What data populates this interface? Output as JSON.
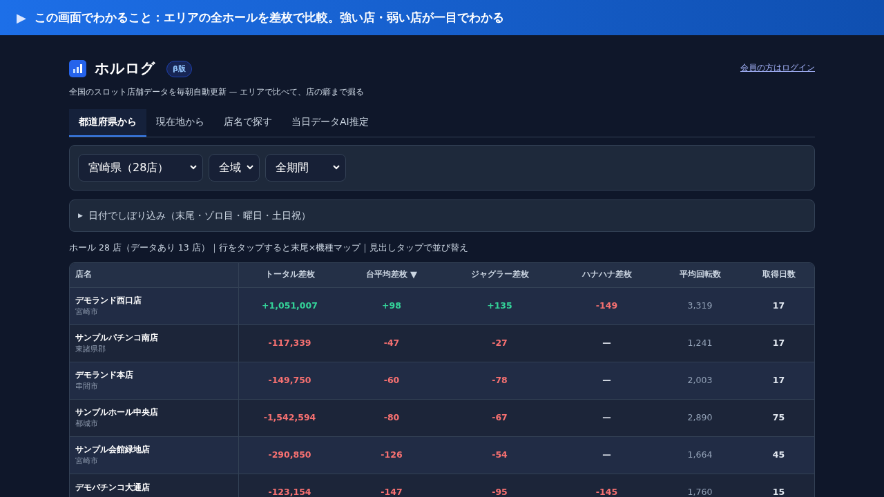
{
  "banner": {
    "arrow": "▶",
    "text": "この画面でわかること：エリアの全ホールを差枚で比較。強い店・弱い店が一目でわかる"
  },
  "header": {
    "title": "ホルログ",
    "badge": "β版",
    "subtitle": "全国のスロット店舗データを毎朝自動更新 — エリアで比べて、店の癖まで掘る",
    "login": "会員の方はログイン"
  },
  "tabs": [
    {
      "label": "都道府県から",
      "selected": true
    },
    {
      "label": "現在地から",
      "selected": false
    },
    {
      "label": "店名で探す",
      "selected": false
    },
    {
      "label": "当日データAI推定",
      "selected": false
    }
  ],
  "filters": [
    {
      "value": "宮崎県（28店）"
    },
    {
      "value": "全域"
    },
    {
      "value": "全期間"
    }
  ],
  "date_filter": {
    "marker": "▶",
    "label": "日付でしぼり込み（末尾・ゾロ目・曜日・土日祝）",
    "expanded": false
  },
  "summary": "ホール 28 店（データあり 13 店）｜行をタップすると末尾×機種マップ｜見出しタップで並び替え",
  "table": {
    "columns": [
      {
        "label": "店名"
      },
      {
        "label": "トータル差枚"
      },
      {
        "label": "台平均差枚",
        "sort_mark": "▼"
      },
      {
        "label": "ジャグラー差枚"
      },
      {
        "label": "ハナハナ差枚"
      },
      {
        "label": "平均回転数"
      },
      {
        "label": "取得日数"
      }
    ],
    "rows": [
      {
        "cells": [
          {
            "text": "デモランド西口店",
            "sub": "宮崎市",
            "kind": "store"
          },
          {
            "text": "+1,051,007",
            "kind": "plus"
          },
          {
            "text": "+98",
            "kind": "plus"
          },
          {
            "text": "+135",
            "kind": "plus"
          },
          {
            "text": "-149",
            "kind": "minus"
          },
          {
            "text": "3,319",
            "kind": "muted"
          },
          {
            "text": "17",
            "kind": "plain"
          }
        ]
      },
      {
        "cells": [
          {
            "text": "サンプルパチンコ南店",
            "sub": "東諸県郡",
            "kind": "store"
          },
          {
            "text": "-117,339",
            "kind": "minus"
          },
          {
            "text": "-47",
            "kind": "minus"
          },
          {
            "text": "-27",
            "kind": "minus"
          },
          {
            "text": "—",
            "kind": "plain"
          },
          {
            "text": "1,241",
            "kind": "muted"
          },
          {
            "text": "17",
            "kind": "plain"
          }
        ]
      },
      {
        "cells": [
          {
            "text": "デモランド本店",
            "sub": "串間市",
            "kind": "store"
          },
          {
            "text": "-149,750",
            "kind": "minus"
          },
          {
            "text": "-60",
            "kind": "minus"
          },
          {
            "text": "-78",
            "kind": "minus"
          },
          {
            "text": "—",
            "kind": "plain"
          },
          {
            "text": "2,003",
            "kind": "muted"
          },
          {
            "text": "17",
            "kind": "plain"
          }
        ]
      },
      {
        "cells": [
          {
            "text": "サンプルホール中央店",
            "sub": "都城市",
            "kind": "store"
          },
          {
            "text": "-1,542,594",
            "kind": "minus"
          },
          {
            "text": "-80",
            "kind": "minus"
          },
          {
            "text": "-67",
            "kind": "minus"
          },
          {
            "text": "—",
            "kind": "plain"
          },
          {
            "text": "2,890",
            "kind": "muted"
          },
          {
            "text": "75",
            "kind": "plain"
          }
        ]
      },
      {
        "cells": [
          {
            "text": "サンプル会館緑地店",
            "sub": "宮崎市",
            "kind": "store"
          },
          {
            "text": "-290,850",
            "kind": "minus"
          },
          {
            "text": "-126",
            "kind": "minus"
          },
          {
            "text": "-54",
            "kind": "minus"
          },
          {
            "text": "—",
            "kind": "plain"
          },
          {
            "text": "1,664",
            "kind": "muted"
          },
          {
            "text": "45",
            "kind": "plain"
          }
        ]
      },
      {
        "cells": [
          {
            "text": "デモパチンコ大通店",
            "kind": "store"
          },
          {
            "text": "-123,154",
            "kind": "minus"
          },
          {
            "text": "-147",
            "kind": "minus"
          },
          {
            "text": "-95",
            "kind": "minus"
          },
          {
            "text": "-145",
            "kind": "minus"
          },
          {
            "text": "1,760",
            "kind": "muted"
          },
          {
            "text": "15",
            "kind": "plain"
          }
        ]
      }
    ]
  }
}
